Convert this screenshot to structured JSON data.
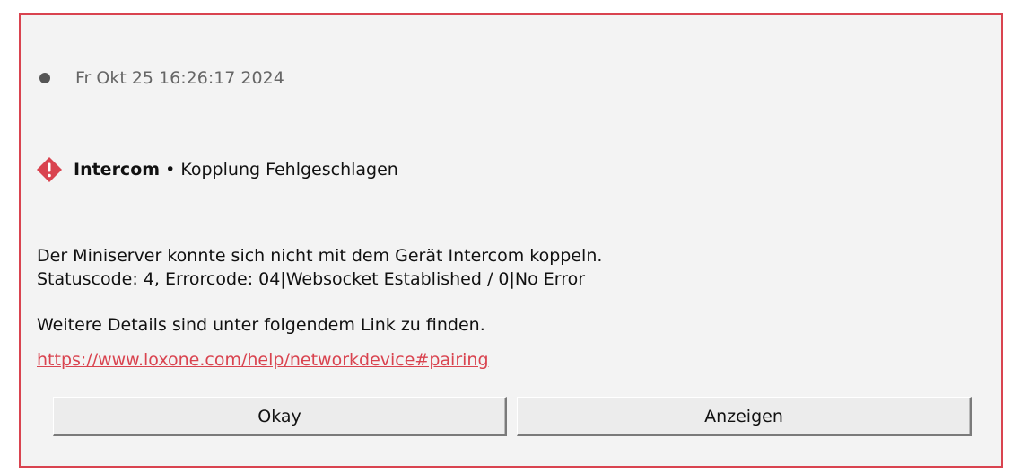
{
  "notification": {
    "timestamp": "Fr Okt 25 16:26:17 2024",
    "device": "Intercom",
    "separator": " • ",
    "title": "Kopplung Fehlgeschlagen",
    "message_line1": "Der Miniserver konnte sich nicht mit dem Gerät Intercom koppeln.",
    "message_line2": "Statuscode: 4, Errorcode: 04|Websocket Established / 0|No Error",
    "details_text": "Weitere Details sind unter folgendem Link zu finden.",
    "link_text": "https://www.loxone.com/help/networkdevice#pairing"
  },
  "buttons": {
    "okay_label": "Okay",
    "show_label": "Anzeigen"
  },
  "icons": {
    "status_dot": "bullet-dot-icon",
    "warning": "warning-diamond-icon"
  },
  "colors": {
    "accent": "#d9434f",
    "background": "#f3f3f3",
    "dot": "#555555"
  }
}
